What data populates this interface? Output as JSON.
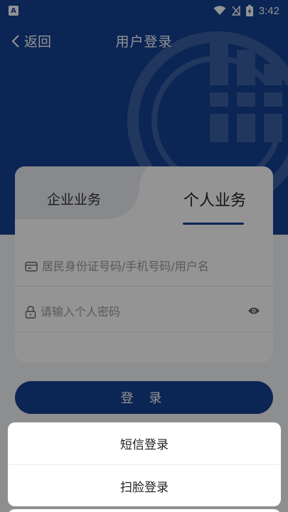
{
  "status_bar": {
    "notification_icon_letter": "A",
    "time": "3:42"
  },
  "header": {
    "back_label": "返回",
    "title": "用户登录"
  },
  "tabs": {
    "enterprise": "企业业务",
    "personal": "个人业务",
    "active": "personal"
  },
  "form": {
    "id_placeholder": "居民身份证号码/手机号码/用户名",
    "password_placeholder": "请输入个人密码"
  },
  "login_button": "登 录",
  "action_sheet": {
    "items": [
      "短信登录",
      "扫脸登录"
    ]
  },
  "colors": {
    "primary": "#134091",
    "background": "#f3f4f7"
  }
}
